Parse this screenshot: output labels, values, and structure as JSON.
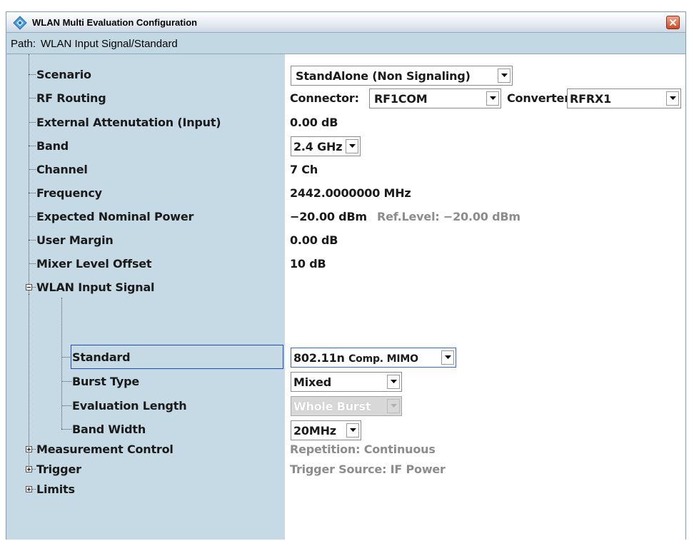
{
  "window": {
    "title": "WLAN Multi Evaluation Configuration",
    "path_label": "Path:",
    "path_value": "WLAN Input Signal/Standard"
  },
  "tree": {
    "scenario": "Scenario",
    "rf_routing": "RF Routing",
    "external_attenuation": "External Attenutation (Input)",
    "band": "Band",
    "channel": "Channel",
    "frequency": "Frequency",
    "expected_nominal_power": "Expected Nominal Power",
    "user_margin": "User Margin",
    "mixer_level_offset": "Mixer Level Offset",
    "wlan_input_signal": "WLAN Input Signal",
    "standard": "Standard",
    "burst_type": "Burst Type",
    "evaluation_length": "Evaluation Length",
    "band_width": "Band Width",
    "measurement_control": "Measurement Control",
    "trigger": "Trigger",
    "limits": "Limits"
  },
  "values": {
    "scenario": "StandAlone (Non Signaling)",
    "connector_label": "Connector:",
    "connector": "RF1COM",
    "converter_label": "Converter:",
    "converter": "RFRX1",
    "external_attenuation": "0.00 dB",
    "band": "2.4 GHz",
    "channel": "7 Ch",
    "frequency": "2442.0000000 MHz",
    "expected_nominal_power": "−20.00 dBm",
    "ref_level": "Ref.Level: −20.00 dBm",
    "user_margin": "0.00 dB",
    "mixer_level_offset": "10 dB",
    "standard_main": "802.11n",
    "standard_sub": "Comp. MIMO",
    "burst_type": "Mixed",
    "evaluation_length": "Whole Burst",
    "band_width": "20MHz",
    "repetition": "Repetition:  Continuous",
    "trigger_source": "Trigger Source:  IF Power"
  },
  "colors": {
    "left_pane": "#c5dae5",
    "path_bar": "#c2d8e3",
    "selection_border": "#1e4fb5"
  }
}
